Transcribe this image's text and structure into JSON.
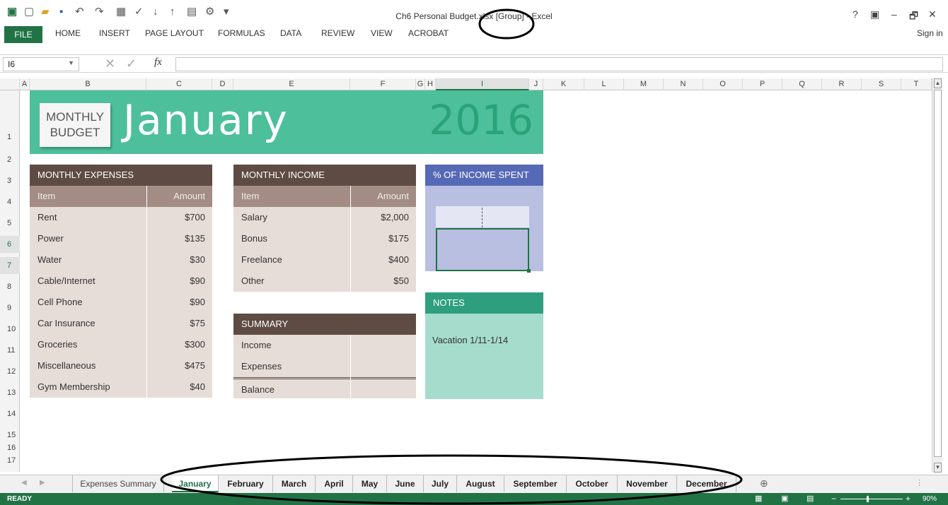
{
  "window": {
    "title": "Ch6 Personal Budget.xlsx [Group] - Excel",
    "sign_in": "Sign in",
    "help": "?",
    "minimize": "–",
    "restore": "🗗",
    "close": "✕"
  },
  "ribbon": {
    "file": "FILE",
    "tabs": [
      "HOME",
      "INSERT",
      "PAGE LAYOUT",
      "FORMULAS",
      "DATA",
      "REVIEW",
      "VIEW",
      "ACROBAT"
    ]
  },
  "formula_bar": {
    "name_box": "I6",
    "fx": "fx",
    "value": ""
  },
  "columns": [
    "A",
    "B",
    "C",
    "D",
    "E",
    "F",
    "G",
    "H",
    "I",
    "J",
    "K",
    "L",
    "M",
    "N",
    "O",
    "P",
    "Q",
    "R",
    "S",
    "T"
  ],
  "rows": [
    "1",
    "2",
    "3",
    "4",
    "5",
    "6",
    "7",
    "8",
    "9",
    "10",
    "11",
    "12",
    "13",
    "14",
    "15",
    "16",
    "17"
  ],
  "banner": {
    "badge_line1": "MONTHLY",
    "badge_line2": "BUDGET",
    "month": "January",
    "year": "2016"
  },
  "expenses": {
    "title": "MONTHLY EXPENSES",
    "col_item": "Item",
    "col_amount": "Amount",
    "rows": [
      {
        "item": "Rent",
        "amount": "$700"
      },
      {
        "item": "Power",
        "amount": "$135"
      },
      {
        "item": "Water",
        "amount": "$30"
      },
      {
        "item": "Cable/Internet",
        "amount": "$90"
      },
      {
        "item": "Cell Phone",
        "amount": "$90"
      },
      {
        "item": "Car Insurance",
        "amount": "$75"
      },
      {
        "item": "Groceries",
        "amount": "$300"
      },
      {
        "item": "Miscellaneous",
        "amount": "$475"
      },
      {
        "item": "Gym Membership",
        "amount": "$40"
      }
    ]
  },
  "income": {
    "title": "MONTHLY INCOME",
    "col_item": "Item",
    "col_amount": "Amount",
    "rows": [
      {
        "item": "Salary",
        "amount": "$2,000"
      },
      {
        "item": "Bonus",
        "amount": "$175"
      },
      {
        "item": "Freelance",
        "amount": "$400"
      },
      {
        "item": "Other",
        "amount": "$50"
      }
    ]
  },
  "summary": {
    "title": "SUMMARY",
    "rows": [
      {
        "label": "Income",
        "value": ""
      },
      {
        "label": "Expenses",
        "value": ""
      },
      {
        "label": "Balance",
        "value": ""
      }
    ]
  },
  "pct_spent": {
    "title": "% OF INCOME SPENT"
  },
  "notes": {
    "title": "NOTES",
    "text": "Vacation 1/11-1/14"
  },
  "sheet_tabs": [
    "Expenses Summary",
    "January",
    "February",
    "March",
    "April",
    "May",
    "June",
    "July",
    "August",
    "September",
    "October",
    "November",
    "December"
  ],
  "active_sheet": "January",
  "status": {
    "ready": "READY",
    "zoom": "90%"
  },
  "colors": {
    "excel_green": "#217346",
    "banner": "#4dbf9b",
    "header_brown": "#5e4b43",
    "pct_blue": "#5669b6",
    "notes_green": "#2e9f7e"
  }
}
